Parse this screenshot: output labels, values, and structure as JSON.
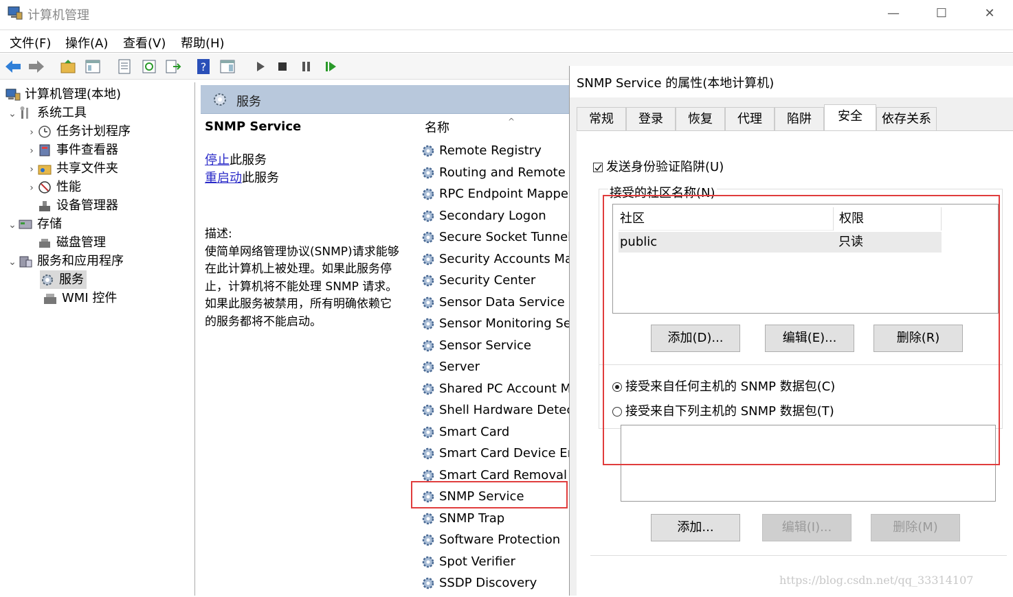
{
  "window": {
    "title": "计算机管理",
    "minimize_glyph": "—",
    "maximize_glyph": "☐",
    "close_glyph": "✕"
  },
  "menu": [
    "文件(F)",
    "操作(A)",
    "查看(V)",
    "帮助(H)"
  ],
  "tree": {
    "root": "计算机管理(本地)",
    "items": [
      {
        "label": "系统工具",
        "icon": "tools-icon",
        "chevron": "⌄"
      },
      {
        "label": "任务计划程序",
        "icon": "clock-icon",
        "chevron": "›"
      },
      {
        "label": "事件查看器",
        "icon": "event-viewer-icon",
        "chevron": "›"
      },
      {
        "label": "共享文件夹",
        "icon": "shared-folder-icon",
        "chevron": "›"
      },
      {
        "label": "性能",
        "icon": "performance-icon",
        "chevron": "›"
      },
      {
        "label": "设备管理器",
        "icon": "device-manager-icon",
        "chevron": ""
      },
      {
        "label": "存储",
        "icon": "storage-icon",
        "chevron": "⌄"
      },
      {
        "label": "磁盘管理",
        "icon": "disk-icon",
        "chevron": ""
      },
      {
        "label": "服务和应用程序",
        "icon": "apps-icon",
        "chevron": "⌄"
      },
      {
        "label": "服务",
        "icon": "services-icon",
        "chevron": ""
      },
      {
        "label": "WMI 控件",
        "icon": "wmi-icon",
        "chevron": ""
      }
    ]
  },
  "services_panel": {
    "header": "服务",
    "selected_name": "SNMP Service",
    "stop_link": "停止",
    "stop_suffix": "此服务",
    "restart_link": "重启动",
    "restart_suffix": "此服务",
    "desc_label": "描述:",
    "desc_lines": [
      "使简单网络管理协议(SNMP)请求能够",
      "在此计算机上被处理。如果此服务停",
      "止，计算机将不能处理 SNMP 请求。",
      "如果此服务被禁用，所有明确依赖它",
      "的服务都将不能启动。"
    ],
    "column_header": "名称",
    "sort_glyph": "^",
    "list": [
      "Remote Registry",
      "Routing and Remote A",
      "RPC Endpoint Mapper",
      "Secondary Logon",
      "Secure Socket Tunneli",
      "Security Accounts Mar",
      "Security Center",
      "Sensor Data Service",
      "Sensor Monitoring Ser",
      "Sensor Service",
      "Server",
      "Shared PC Account Ma",
      "Shell Hardware Detect",
      "Smart Card",
      "Smart Card Device Enu",
      "Smart Card Removal P",
      "SNMP Service",
      "SNMP Trap",
      "Software Protection",
      "Spot Verifier",
      "SSDP Discovery"
    ]
  },
  "dialog": {
    "title": "SNMP Service 的属性(本地计算机)",
    "tabs": [
      "常规",
      "登录",
      "恢复",
      "代理",
      "陷阱",
      "安全",
      "依存关系"
    ],
    "send_trap_label": "发送身份验证陷阱(U)",
    "community_group_label": "接受的社区名称(N)",
    "table_headers": [
      "社区",
      "权限"
    ],
    "table_rows": [
      [
        "public",
        "只读"
      ]
    ],
    "buttons_top": [
      "添加(D)...",
      "编辑(E)...",
      "删除(R)"
    ],
    "radio_any": "接受来自任何主机的 SNMP 数据包(C)",
    "radio_list": "接受来自下列主机的 SNMP 数据包(T)",
    "buttons_bottom": [
      "添加...",
      "编辑(I)...",
      "删除(M)"
    ]
  },
  "watermark": "https://blog.csdn.net/qq_33314107",
  "colors": {
    "highlight": "#e03c3c",
    "header_bg": "#b8c8dc"
  }
}
